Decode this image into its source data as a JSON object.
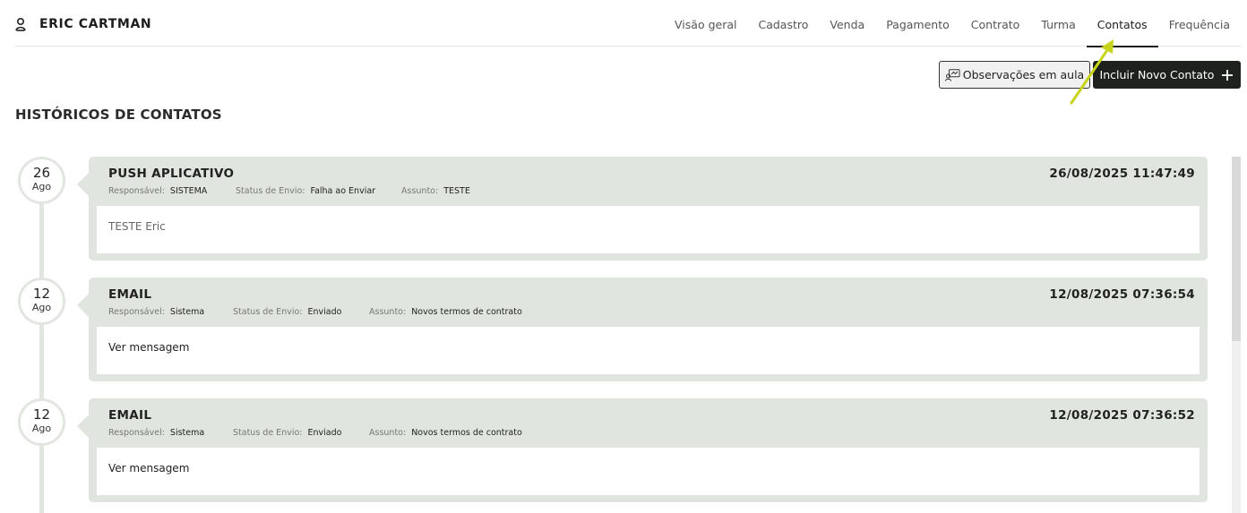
{
  "header": {
    "user_name": "ERIC CARTMAN",
    "user_icon": "user-icon"
  },
  "tabs": [
    {
      "label": "Visão geral",
      "active": false
    },
    {
      "label": "Cadastro",
      "active": false
    },
    {
      "label": "Venda",
      "active": false
    },
    {
      "label": "Pagamento",
      "active": false
    },
    {
      "label": "Contrato",
      "active": false
    },
    {
      "label": "Turma",
      "active": false
    },
    {
      "label": "Contatos",
      "active": true
    },
    {
      "label": "Frequência",
      "active": false
    }
  ],
  "actions": {
    "observacoes_label": "Observações em aula",
    "novo_contato_label": "Incluir Novo Contato"
  },
  "section": {
    "title": "HISTÓRICOS DE CONTATOS"
  },
  "labels": {
    "responsavel": "Responsável:",
    "status": "Status de Envio:",
    "assunto": "Assunto:"
  },
  "contacts": [
    {
      "day": "26",
      "month": "Ago",
      "type": "PUSH APLICATIVO",
      "datetime": "26/08/2025 11:47:49",
      "responsavel": "SISTEMA",
      "status": "Falha ao Enviar",
      "assunto": "TESTE",
      "message": "TESTE Eric"
    },
    {
      "day": "12",
      "month": "Ago",
      "type": "EMAIL",
      "datetime": "12/08/2025 07:36:54",
      "responsavel": "Sistema",
      "status": "Enviado",
      "assunto": "Novos termos de contrato",
      "message": "Ver mensagem"
    },
    {
      "day": "12",
      "month": "Ago",
      "type": "EMAIL",
      "datetime": "12/08/2025 07:36:52",
      "responsavel": "Sistema",
      "status": "Enviado",
      "assunto": "Novos termos de contrato",
      "message": "Ver mensagem"
    }
  ],
  "colors": {
    "card_bg": "#e1e5df",
    "primary_button": "#1f211f",
    "annotation_arrow": "#c8d41a"
  }
}
